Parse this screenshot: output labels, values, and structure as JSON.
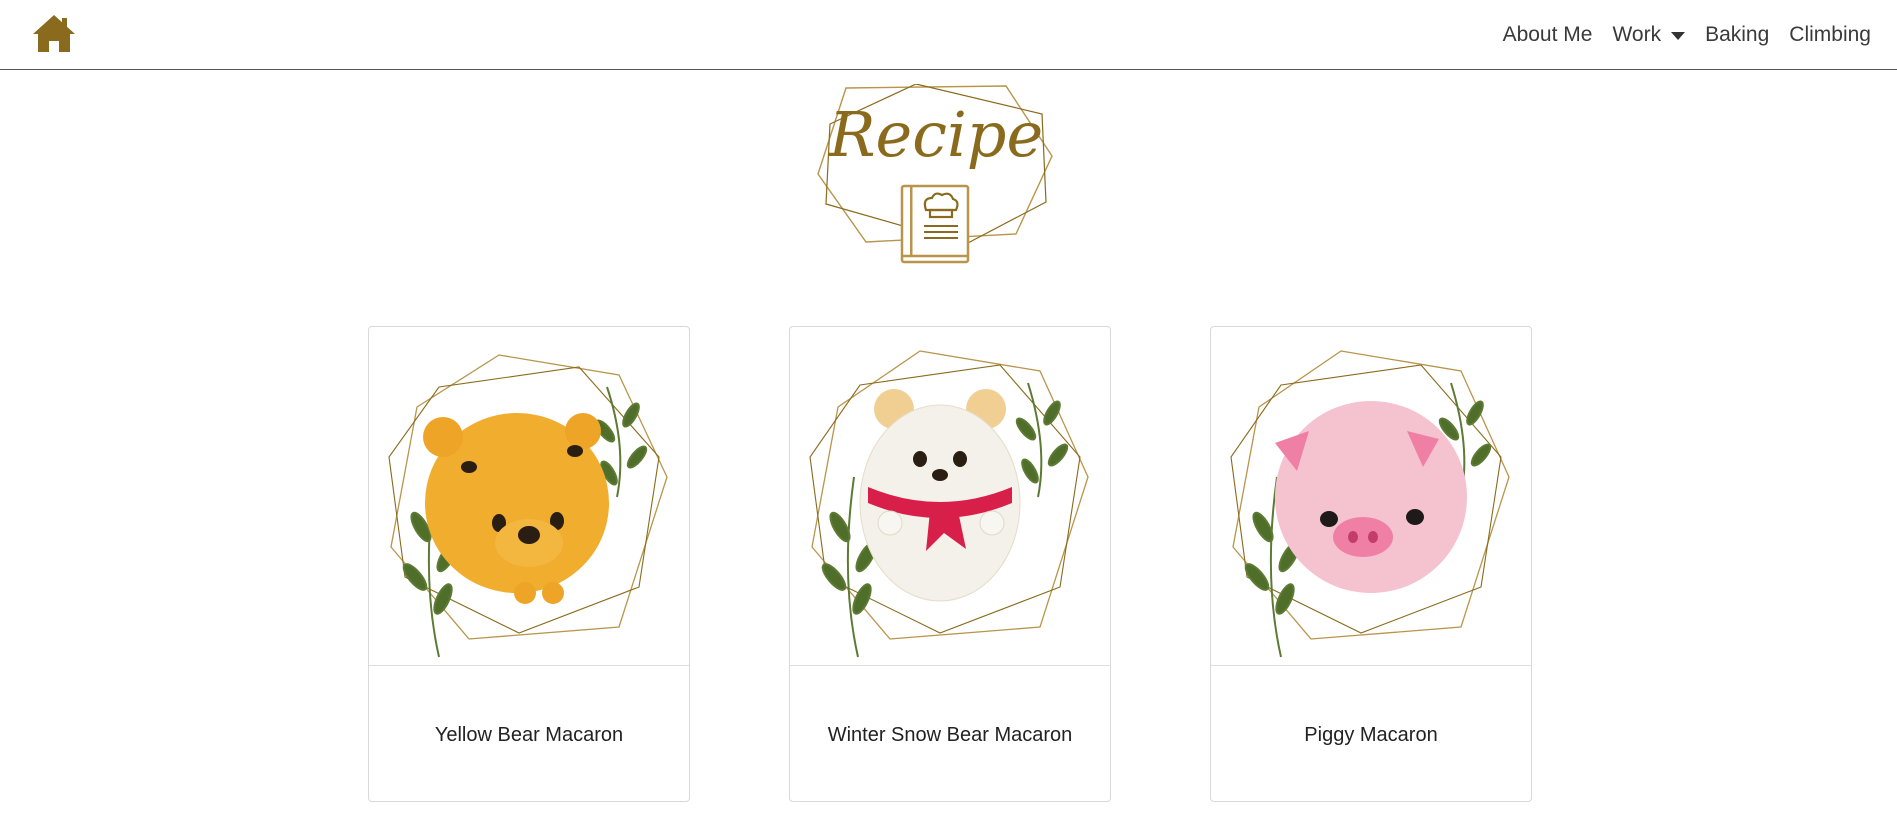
{
  "nav": {
    "home_icon": "home-icon",
    "items": [
      {
        "label": "About Me"
      },
      {
        "label": "Work",
        "dropdown": true
      },
      {
        "label": "Baking"
      },
      {
        "label": "Climbing"
      }
    ]
  },
  "logo": {
    "title": "Recipe",
    "icon": "chef-book-icon",
    "color": "#8a6a1c"
  },
  "cards": [
    {
      "title": "Yellow Bear Macaron",
      "image": "yellow-bear-macaron",
      "color": "#f0ad2e"
    },
    {
      "title": "Winter Snow Bear Macaron",
      "image": "winter-snow-bear-macaron",
      "color": "#f4f1ea"
    },
    {
      "title": "Piggy Macaron",
      "image": "piggy-macaron",
      "color": "#f5bccb"
    }
  ],
  "colors": {
    "brand_gold": "#8a6a1c",
    "gold_line": "#b8954a"
  }
}
